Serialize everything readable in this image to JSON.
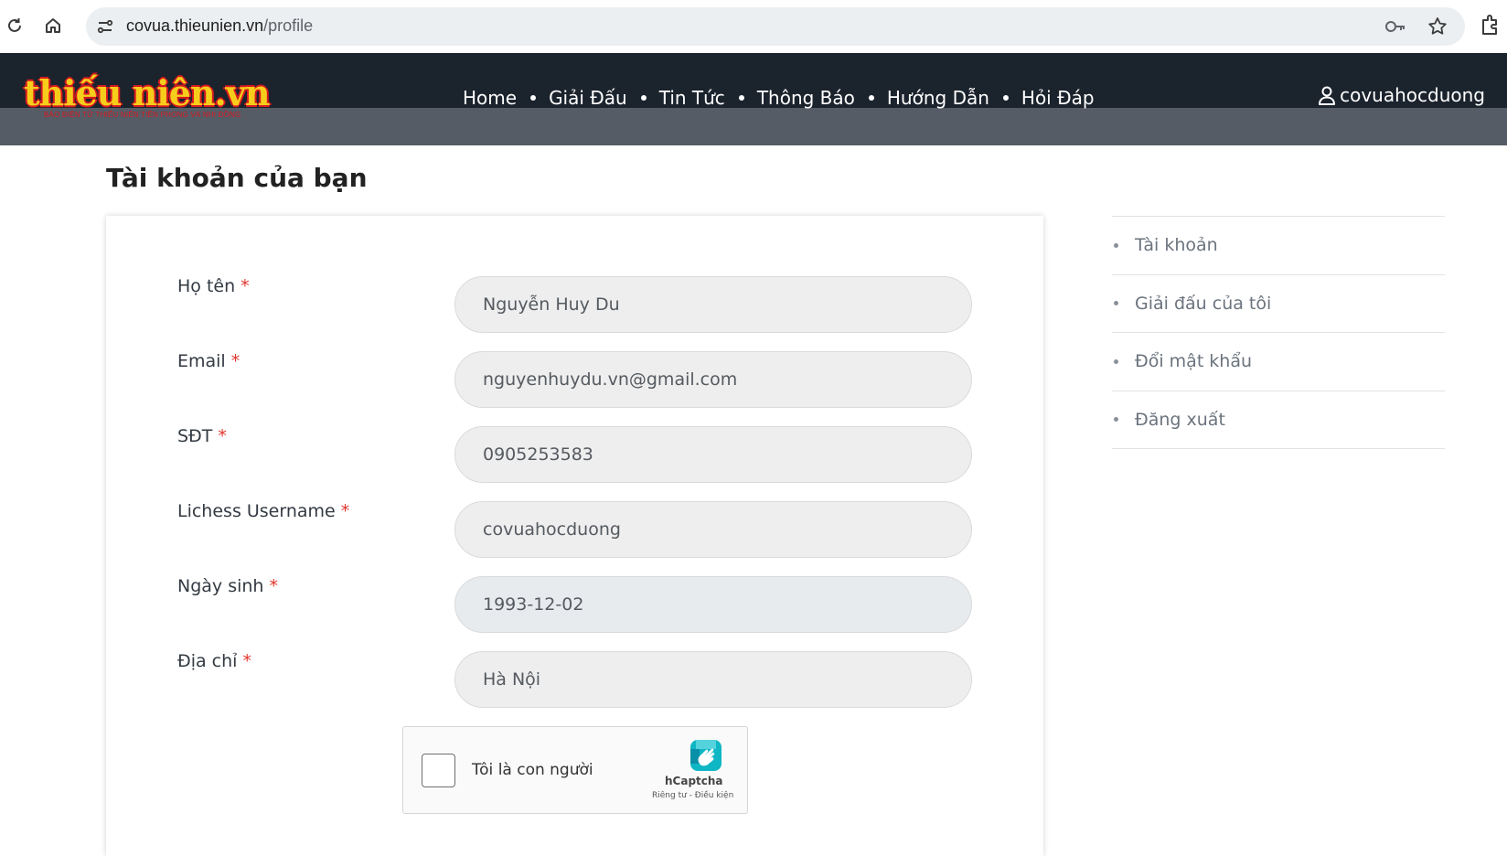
{
  "browser": {
    "url_domain": "covua.thieunien.vn",
    "url_path": "/profile"
  },
  "header": {
    "logo_text": "thiếu niên.vn",
    "logo_tagline": "BÁO ĐIỆN TỬ THIẾU NIÊN TIỀN PHONG VÀ NHI ĐỒNG",
    "nav": [
      "Home",
      "Giải Đấu",
      "Tin Tức",
      "Thông Báo",
      "Hướng Dẫn",
      "Hỏi Đáp"
    ],
    "username": "covuahocduong"
  },
  "page": {
    "title": "Tài khoản của bạn"
  },
  "form": {
    "required_mark": "*",
    "fields": [
      {
        "label": "Họ tên",
        "value": "Nguyễn Huy Du"
      },
      {
        "label": "Email",
        "value": "nguyenhuydu.vn@gmail.com"
      },
      {
        "label": "SĐT",
        "value": "0905253583"
      },
      {
        "label": "Lichess Username",
        "value": "covuahocduong"
      },
      {
        "label": "Ngày sinh",
        "value": "1993-12-02"
      },
      {
        "label": "Địa chỉ",
        "value": "Hà Nội"
      }
    ],
    "captcha": {
      "label": "Tôi là con người",
      "brand": "hCaptcha",
      "terms": "Riêng tư - Điều kiện"
    }
  },
  "side_menu": {
    "items": [
      "Tài khoản",
      "Giải đấu của tôi",
      "Đổi mật khẩu",
      "Đăng xuất"
    ]
  },
  "colors": {
    "header_bg": "#1b232d",
    "header_band": "#555c66",
    "required": "#e0362c",
    "input_bg": "#eeeeee"
  }
}
